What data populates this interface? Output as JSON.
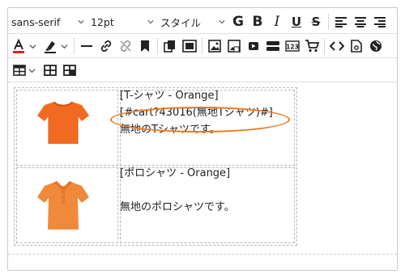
{
  "toolbar": {
    "font_family": "sans-serif",
    "font_size": "12pt",
    "style_label": "スタイル",
    "bold_G": "G",
    "bold_B": "B",
    "italic_I": "I",
    "underline_U": "U",
    "strike_S": "S",
    "numbers_icon_label": "123"
  },
  "table": {
    "rows": [
      {
        "image": "orange-tshirt",
        "title": "[T-シャツ - Orange]",
        "cart_tag": "[#cart?43016(無地Tシャツ)#]",
        "description": "無地のTシャツです。"
      },
      {
        "image": "orange-polo-shirt",
        "title": "[ポロシャツ - Orange]",
        "description": "無地のポロシャツです。"
      }
    ]
  },
  "colors": {
    "highlight_ellipse": "#f07a1c",
    "tshirt": "#f26a1f",
    "polo": "#f08a3a",
    "font_color_bar": "#e02020"
  }
}
